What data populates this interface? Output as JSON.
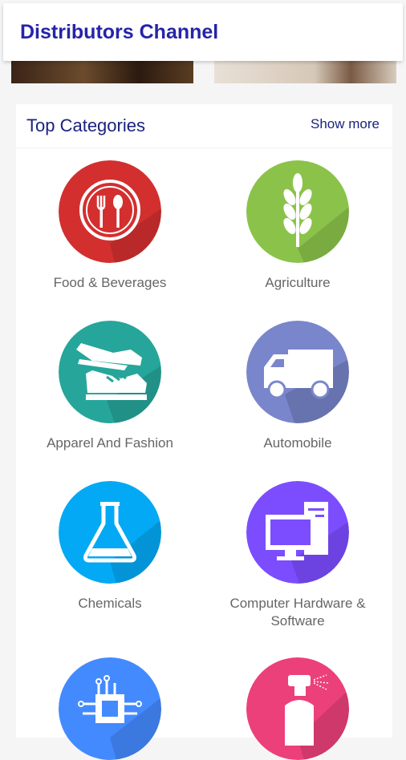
{
  "app": {
    "title": "Distributors Channel"
  },
  "section": {
    "heading": "Top Categories",
    "show_more": "Show more"
  },
  "categories": [
    {
      "label": "Food & Beverages",
      "icon": "fork-spoon-icon",
      "color": "#d32f2f"
    },
    {
      "label": "Agriculture",
      "icon": "wheat-icon",
      "color": "#8bc34a"
    },
    {
      "label": "Apparel And Fashion",
      "icon": "shoes-icon",
      "color": "#26a69a"
    },
    {
      "label": "Automobile",
      "icon": "truck-icon",
      "color": "#7986cb"
    },
    {
      "label": "Chemicals",
      "icon": "flask-icon",
      "color": "#03a9f4"
    },
    {
      "label": "Computer Hardware & Software",
      "icon": "computer-icon",
      "color": "#7c4dff"
    },
    {
      "label": "",
      "icon": "circuit-chip-icon",
      "color": "#448aff"
    },
    {
      "label": "",
      "icon": "spray-bottle-icon",
      "color": "#ec407a"
    }
  ]
}
